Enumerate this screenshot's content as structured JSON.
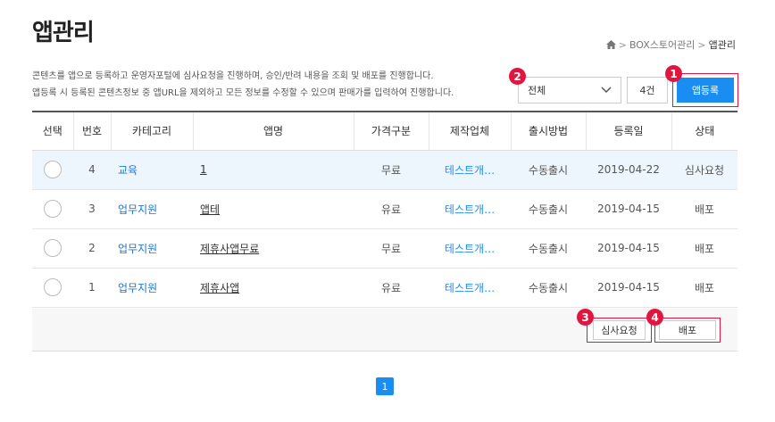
{
  "page": {
    "title": "앱관리"
  },
  "breadcrumb": {
    "items": [
      "BOX스토어관리",
      "앱관리"
    ]
  },
  "description": {
    "line1": "콘텐츠를 앱으로 등록하고 운영자포털에 심사요청을 진행하며, 승인/반려 내용을 조회 및 배포를 진행합니다.",
    "line2": "앱등록 시 등록된 콘텐츠정보 중 앱URL을 제외하고 모든 정보를 수정할 수 있으며 판매가를 입력하여 진행합니다."
  },
  "filter": {
    "selected": "전체"
  },
  "count": "4건",
  "register_button": "앱등록",
  "badges": {
    "register": "1",
    "filter": "2",
    "review": "3",
    "deploy": "4"
  },
  "table": {
    "headers": [
      "선택",
      "번호",
      "카테고리",
      "앱명",
      "가격구분",
      "제작업체",
      "출시방법",
      "등록일",
      "상태"
    ],
    "rows": [
      {
        "no": "4",
        "category": "교육",
        "app": "1",
        "price": "무료",
        "maker": "테스트개…",
        "release": "수동출시",
        "date": "2019-04-22",
        "status": "심사요청"
      },
      {
        "no": "3",
        "category": "업무지원",
        "app": "앱테",
        "price": "유료",
        "maker": "테스트개…",
        "release": "수동출시",
        "date": "2019-04-15",
        "status": "배포"
      },
      {
        "no": "2",
        "category": "업무지원",
        "app": "제휴사앱무료",
        "price": "무료",
        "maker": "테스트개…",
        "release": "수동출시",
        "date": "2019-04-15",
        "status": "배포"
      },
      {
        "no": "1",
        "category": "업무지원",
        "app": "제휴사앱",
        "price": "유료",
        "maker": "테스트개…",
        "release": "수동출시",
        "date": "2019-04-15",
        "status": "배포"
      }
    ]
  },
  "actions": {
    "review": "심사요청",
    "deploy": "배포"
  },
  "pagination": {
    "current": "1"
  },
  "colors": {
    "accent": "#1a8df2",
    "highlight": "#e0163f",
    "selected_row": "#eef6fd"
  }
}
